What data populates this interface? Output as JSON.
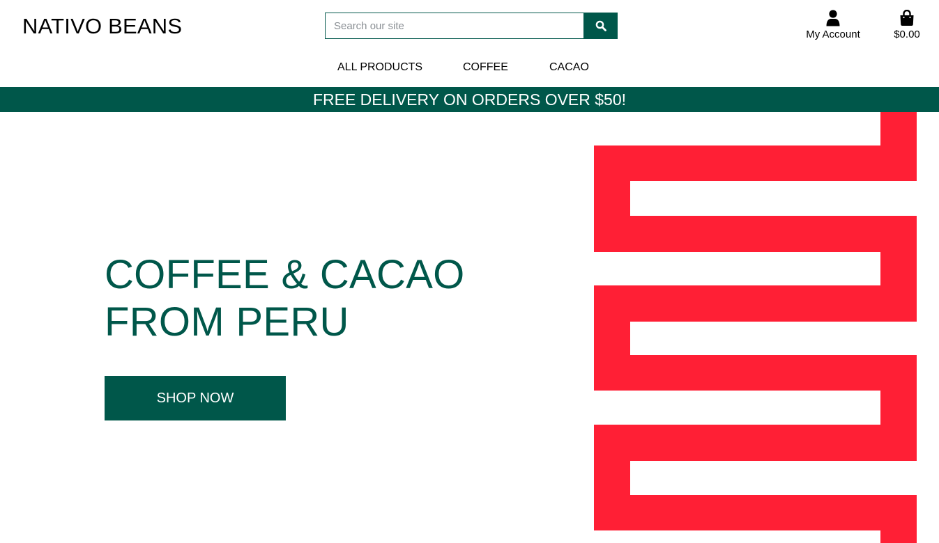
{
  "brand": {
    "name": "NATIVO BEANS"
  },
  "search": {
    "placeholder": "Search our site",
    "icon": "search-icon"
  },
  "account": {
    "label": "My Account",
    "icon": "user-icon"
  },
  "cart": {
    "total": "$0.00",
    "icon": "shopping-bag-icon"
  },
  "nav": {
    "items": [
      {
        "label": "ALL PRODUCTS"
      },
      {
        "label": "COFFEE"
      },
      {
        "label": "CACAO"
      }
    ]
  },
  "banner": {
    "text": "FREE DELIVERY ON ORDERS OVER $50!"
  },
  "hero": {
    "title_line1": "COFFEE & CACAO",
    "title_line2": "FROM PERU",
    "cta_label": "SHOP NOW"
  },
  "colors": {
    "brand_green": "#00574a",
    "accent_red": "#ff1f35",
    "background": "#ffffff"
  }
}
